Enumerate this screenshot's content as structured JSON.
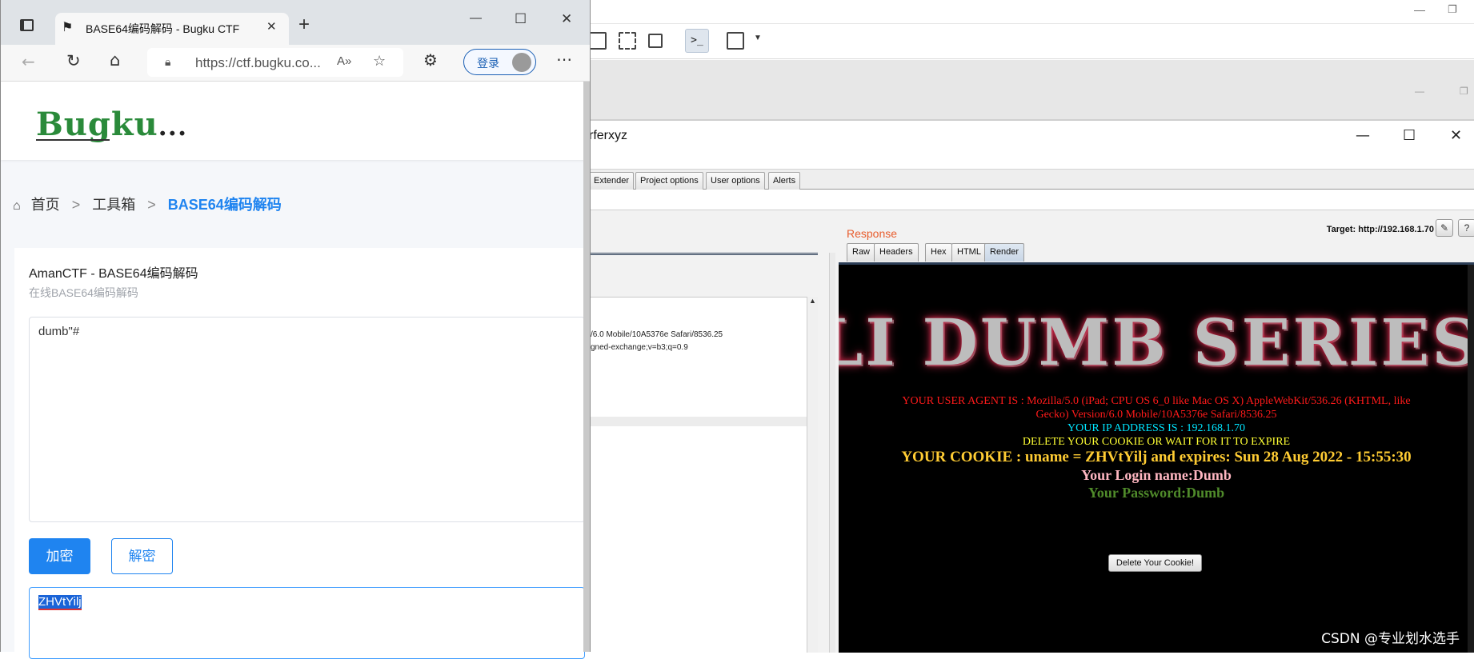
{
  "edge": {
    "tab_title": "BASE64编码解码 - Bugku CTF",
    "url": "https://ctf.bugku.co...",
    "login_label": "登录",
    "logo_text": "Bugku",
    "logo_dots": "...",
    "breadcrumb": {
      "home": "首页",
      "tools": "工具箱",
      "current": "BASE64编码解码",
      "sep": ">"
    },
    "card_title": "AmanCTF - BASE64编码解码",
    "card_subtitle": "在线BASE64编码解码",
    "input_value": "dumb\"#",
    "encode_label": "加密",
    "decode_label": "解密",
    "output_value": "ZHVtYilj"
  },
  "burp": {
    "window_title": "rferxyz",
    "tabs": [
      "Extender",
      "Project options",
      "User options",
      "Alerts"
    ],
    "target_label": "Target: http://192.168.1.70",
    "request_lines": [
      "/6.0 Mobile/10A5376e Safari/8536.25",
      "gned-exchange;v=b3;q=0.9"
    ],
    "response_label": "Response",
    "response_tabs": [
      "Raw",
      "Headers",
      "Hex",
      "HTML",
      "Render"
    ],
    "selected_response_tab": "Render",
    "render": {
      "banner": "LI DUMB SERIES",
      "user_agent_1": "YOUR USER AGENT IS : Mozilla/5.0 (iPad; CPU OS 6_0 like Mac OS X) AppleWebKit/536.26 (KHTML, like",
      "user_agent_2": "Gecko) Version/6.0 Mobile/10A5376e Safari/8536.25",
      "ip": "YOUR IP ADDRESS IS : 192.168.1.70",
      "delete_msg": "DELETE YOUR COOKIE OR WAIT FOR IT TO EXPIRE",
      "cookie": "YOUR COOKIE : uname = ZHVtYilj and expires: Sun 28 Aug 2022 - 15:55:30",
      "login_name": "Your Login name:Dumb",
      "password": "Your Password:Dumb",
      "delete_button": "Delete Your Cookie!"
    }
  },
  "watermark": "CSDN @专业划水选手",
  "colors": {
    "accent_blue": "#1f84f0",
    "response_orange": "#e85c2c",
    "render_red": "#ff1a1a",
    "render_cyan": "#00e5ff",
    "render_yellow": "#ffff33",
    "render_gold": "#ffcc33",
    "render_pink": "#ffb6c1",
    "render_green": "#4f8a2a"
  }
}
